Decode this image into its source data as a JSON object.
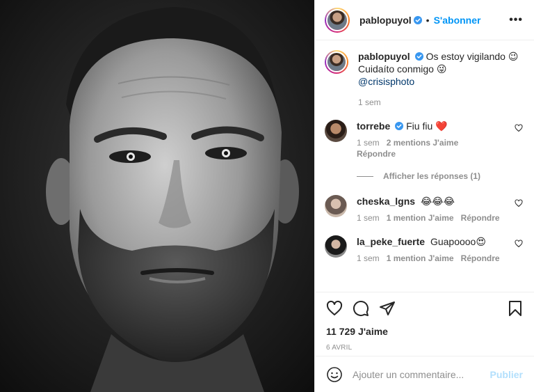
{
  "header": {
    "username": "pablopuyol",
    "separator": "•",
    "follow_label": "S'abonner",
    "more_label": "•••"
  },
  "caption": {
    "username": "pablopuyol",
    "text_line1": "Os estoy vigilando 😉",
    "text_line2": "Cuidaíto conmigo 😜",
    "mention": "@crisisphoto",
    "time": "1 sem"
  },
  "comments": [
    {
      "username": "torrebe",
      "verified": true,
      "text": "Fiu fiu ❤️",
      "time": "1 sem",
      "likes": "2 mentions J'aime",
      "reply_label": "Répondre"
    },
    {
      "username": "cheska_lgns",
      "verified": false,
      "text": "😂😂😂",
      "time": "1 sem",
      "likes": "1 mention J'aime",
      "reply_label": "Répondre"
    },
    {
      "username": "la_peke_fuerte",
      "verified": false,
      "text": "Guapoooo😍",
      "time": "1 sem",
      "likes": "1 mention J'aime",
      "reply_label": "Répondre"
    }
  ],
  "show_replies_label": "Afficher les réponses (1)",
  "actions": {
    "likes_count": "11 729 J'aime",
    "date": "6 AVRIL"
  },
  "add_comment": {
    "placeholder": "Ajouter un commentaire...",
    "publish_label": "Publier"
  },
  "colors": {
    "accent": "#0095f6",
    "publish_disabled": "#b2dffc",
    "muted": "#8e8e8e",
    "text": "#262626"
  }
}
